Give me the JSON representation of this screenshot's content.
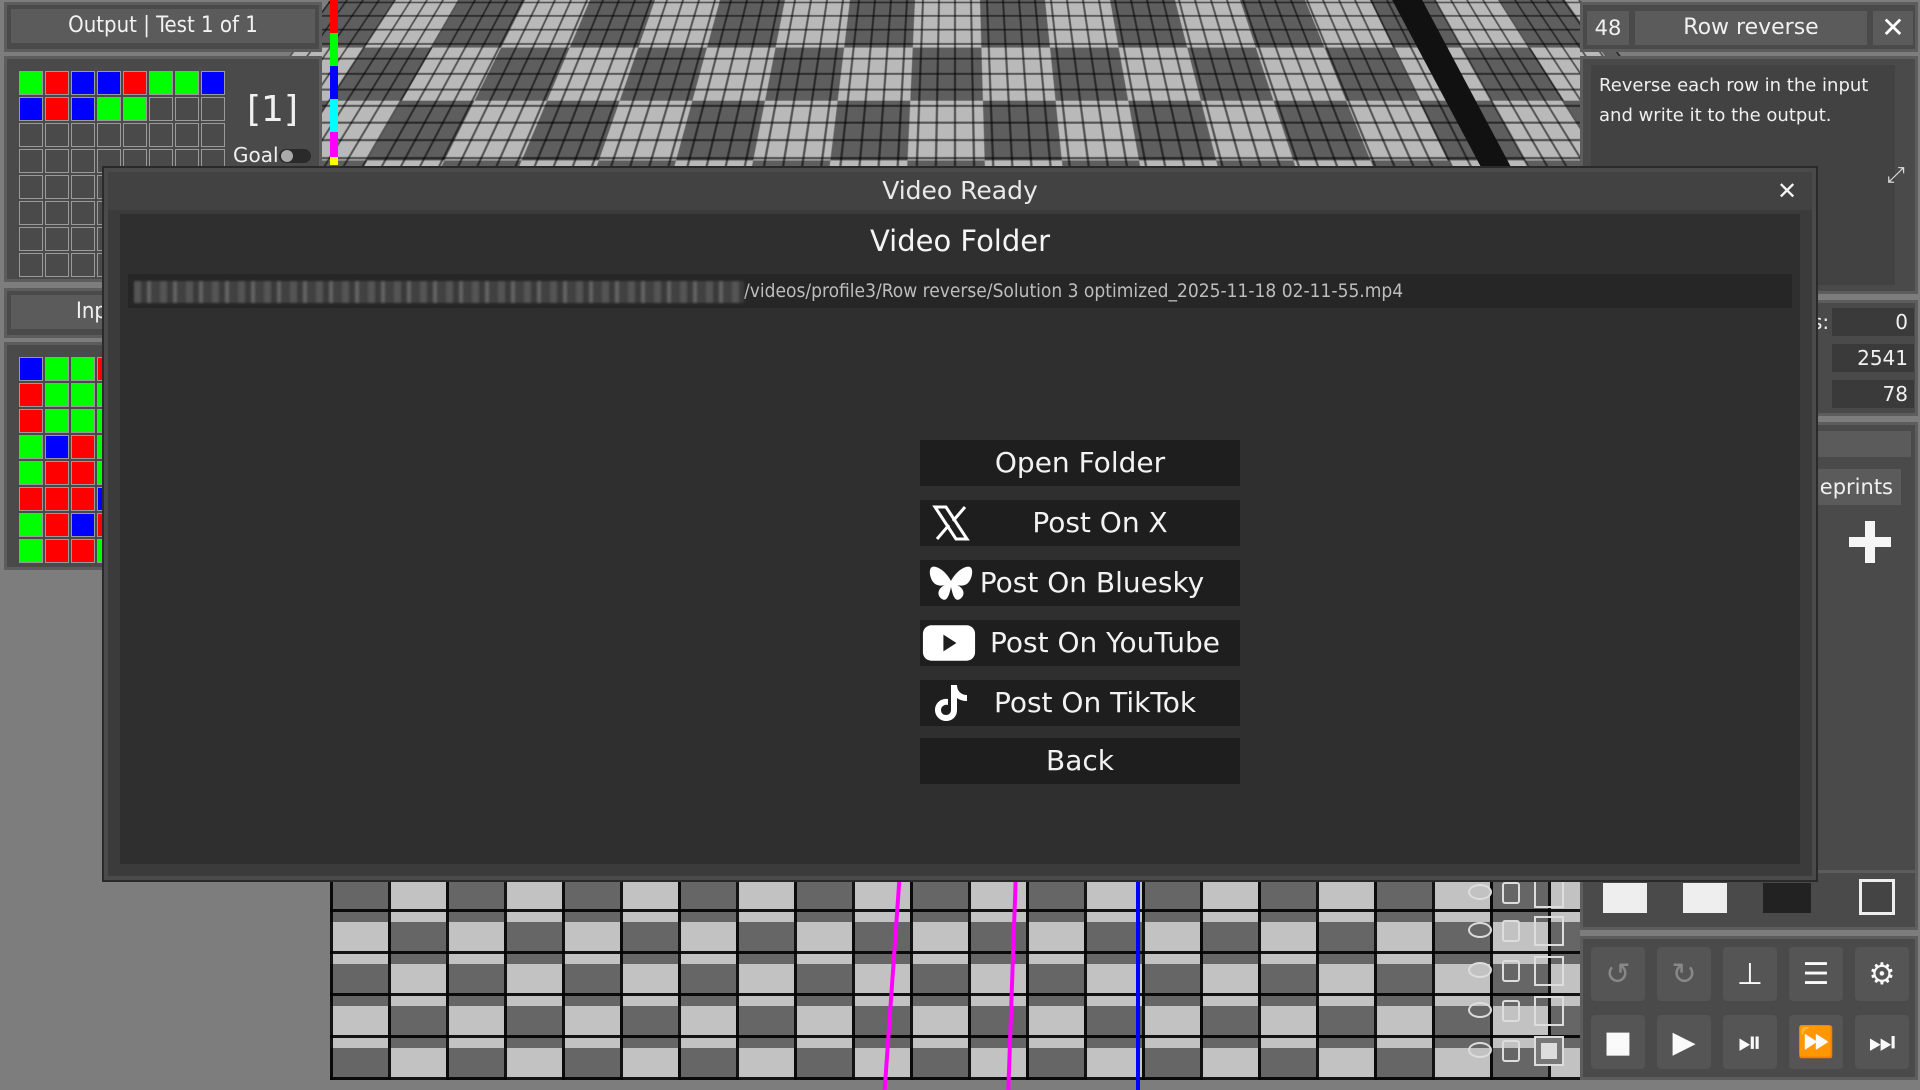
{
  "left_panel": {
    "output_title": "Output | Test 1 of 1",
    "index_label": "[1]",
    "goal_label": "Goal",
    "input_title_partial": "Inp"
  },
  "task": {
    "number": "48",
    "name": "Row reverse",
    "description_line1": "Reverse each row in the input",
    "description_line2": "and write it to the output."
  },
  "stats": {
    "label_partial": "s:",
    "value1": "0",
    "value2": "2541",
    "value3": "78"
  },
  "blueprints": {
    "tab_partial": "eprints"
  },
  "modal": {
    "title": "Video Ready",
    "close_glyph": "✕",
    "folder_heading": "Video Folder",
    "path_visible": "/videos/profile3/Row reverse/Solution 3 optimized_2025-11-18 02-11-55.mp4",
    "buttons": {
      "open_folder": "Open Folder",
      "post_x": "Post On X",
      "post_bluesky": "Post On Bluesky",
      "post_youtube": "Post On YouTube",
      "post_tiktok": "Post On TikTok",
      "back": "Back"
    }
  },
  "colors": {
    "grid_red": "#ff0000",
    "grid_green": "#00ff00",
    "grid_blue": "#0000ff",
    "wire_magenta": "#ff00ff",
    "wire_blue": "#0000ff"
  },
  "icons": [
    "x-logo-icon",
    "bluesky-icon",
    "youtube-icon",
    "tiktok-icon",
    "undo-icon",
    "redo-icon",
    "stamp-icon",
    "menu-icon",
    "gear-icon",
    "stop-icon",
    "play-icon",
    "step-icon",
    "fast-forward-icon",
    "fastest-icon"
  ]
}
